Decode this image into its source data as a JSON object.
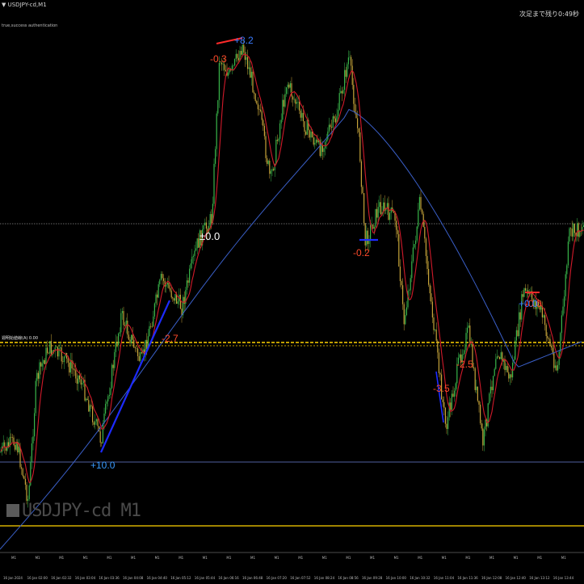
{
  "window": {
    "title": "▼ USDJPY-cd,M1",
    "subtitle": "true,success authentication",
    "top_right": "次足まで残り0:49秒",
    "level_label": "週明始値線(A) 0.00",
    "watermark": "USDJPY-cd M1"
  },
  "colors": {
    "background": "#000000",
    "ma_fast": "#d11a2a",
    "ma_slow": "#3a5fc8",
    "bull": "#39b54a",
    "bear": "#c6a43a",
    "level_yellow": "#ffd200",
    "trend_blue": "#1d2bff",
    "white_dotted": "#cfcfcf"
  },
  "annotations": [
    {
      "id": "ann-1",
      "text": "-0.3",
      "color": "#ff4a2a"
    },
    {
      "id": "ann-2",
      "text": "+8.2",
      "color": "#3a7bff"
    },
    {
      "id": "ann-3",
      "text": "±0.0",
      "color": "#ffffff"
    },
    {
      "id": "ann-4",
      "text": "-0.2",
      "color": "#ff4a2a"
    },
    {
      "id": "ann-5",
      "text": "-0.0",
      "color": "#ff4a2a"
    },
    {
      "id": "ann-6",
      "text": "+0.0",
      "color": "#3a7bff"
    },
    {
      "id": "ann-7",
      "text": "+10.0",
      "color": "#3a9bff"
    },
    {
      "id": "ann-8",
      "text": "-2.7",
      "color": "#ff4a2a"
    },
    {
      "id": "ann-9",
      "text": "-3.5",
      "color": "#ff4a2a"
    },
    {
      "id": "ann-10",
      "text": "-2.5",
      "color": "#ff4a2a"
    }
  ],
  "x_axis": [
    "16 Jan 2024",
    "16 Jan 02:00",
    "16 Jan 02:32",
    "16 Jan 03:04",
    "16 Jan 03:36",
    "16 Jan 04:08",
    "16 Jan 04:40",
    "16 Jan 05:12",
    "16 Jan 05:44",
    "16 Jan 06:16",
    "16 Jan 06:48",
    "16 Jan 07:20",
    "16 Jan 07:52",
    "16 Jan 08:24",
    "16 Jan 08:56",
    "16 Jan 09:28",
    "16 Jan 10:00",
    "16 Jan 10:32",
    "16 Jan 11:04",
    "16 Jan 11:36",
    "16 Jan 12:08",
    "16 Jan 12:40",
    "16 Jan 13:12",
    "16 Jan 13:44"
  ]
}
